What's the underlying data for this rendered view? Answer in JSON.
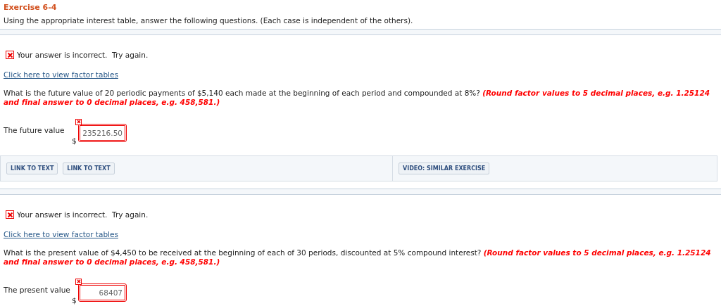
{
  "header": {
    "title": "Exercise 6-4",
    "instructions": "Using the appropriate interest table, answer the following questions. (Each case is independent of the others)."
  },
  "questions": [
    {
      "correct": false,
      "feedback": "Your answer is incorrect.  Try again.",
      "factor_link": "Click here to view factor tables",
      "question": "What is the future value of 20 periodic payments of $5,140 each made at the beginning of each period and compounded at 8%? **(Round factor values to 5 decimal places, e.g. 1.25124 and final answer to 0 decimal places, e.g. 458,581.)**",
      "answer_label": "The future value",
      "currency": "$",
      "answer_value": "235216.50",
      "links": [
        "LINK TO TEXT",
        "LINK TO TEXT"
      ],
      "video_link": "VIDEO: SIMILAR EXERCISE"
    },
    {
      "correct": false,
      "feedback": "Your answer is incorrect.  Try again.",
      "factor_link": "Click here to view factor tables",
      "question": "What is the present value of $4,450 to be received at the beginning of each of 30 periods, discounted at 5% compound interest? **(Round factor values to 5 decimal places, e.g. 1.25124 and final answer to 0 decimal places, e.g. 458,581.)**",
      "answer_label": "The present value",
      "currency": "$",
      "answer_value": "68407"
    }
  ]
}
